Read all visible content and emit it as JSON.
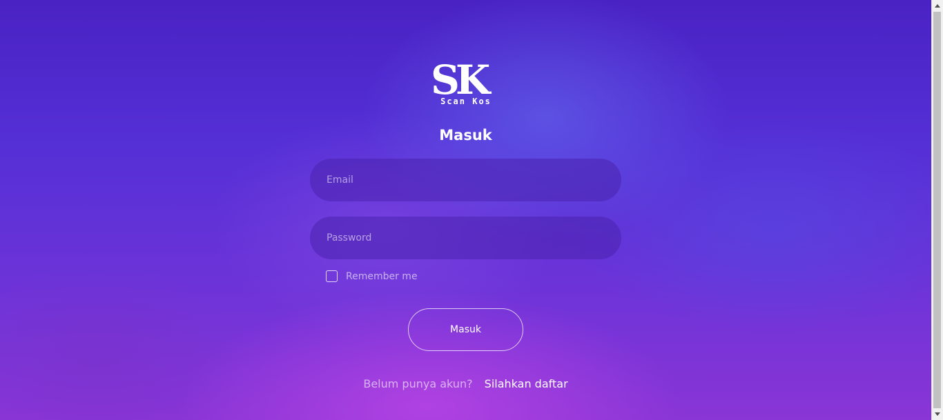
{
  "brand": {
    "logo_text": "SK",
    "logo_subtitle": "Scan Kos"
  },
  "login": {
    "title": "Masuk",
    "email_placeholder": "Email",
    "password_placeholder": "Password",
    "remember_label": "Remember me",
    "remember_checked": false,
    "submit_label": "Masuk"
  },
  "register": {
    "question": "Belum punya akun?",
    "link_label": "Silahkan daftar"
  },
  "icons": {
    "scroll_up": "chevron-up-icon",
    "scroll_down": "chevron-down-icon"
  },
  "colors": {
    "background_top": "#4a22c4",
    "background_bottom": "#8a35d6",
    "text": "#ffffff"
  }
}
